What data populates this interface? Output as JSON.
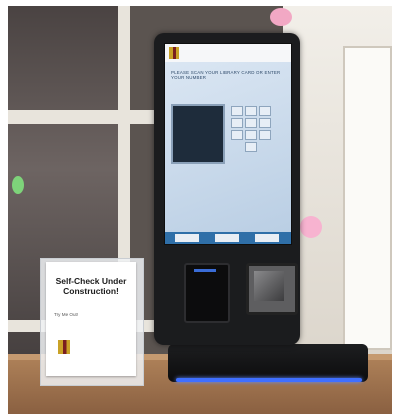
{
  "screen": {
    "header_text": "",
    "prompt_text": "PLEASE SCAN YOUR LIBRARY CARD OR ENTER YOUR NUMBER"
  },
  "sign": {
    "title": "Self-Check Under Construction!",
    "subtitle": "Try Me Out!",
    "logo_text": ""
  },
  "kiosk": {
    "brand_strip_text": ""
  },
  "colors": {
    "accent_led": "#3f6fff",
    "screen_blue": "#2f6fa8",
    "logo_gold": "#c9a227",
    "logo_maroon": "#7a1f1f"
  }
}
